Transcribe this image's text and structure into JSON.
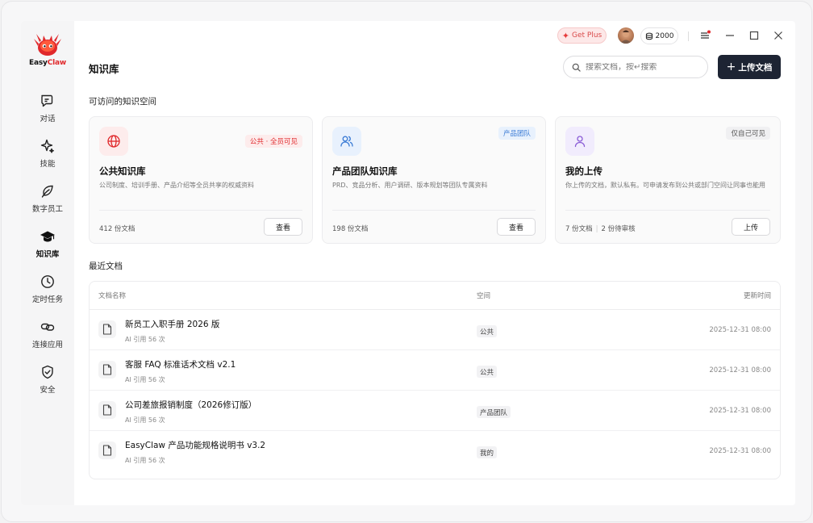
{
  "app": {
    "brand_prefix": "Easy",
    "brand_suffix": "Claw"
  },
  "sidebar": {
    "items": [
      {
        "label": "对话",
        "icon": "chat-icon"
      },
      {
        "label": "技能",
        "icon": "sparkle-icon"
      },
      {
        "label": "数字员工",
        "icon": "leaf-icon"
      },
      {
        "label": "知识库",
        "icon": "graduation-cap-icon",
        "active": true
      },
      {
        "label": "定时任务",
        "icon": "clock-icon"
      },
      {
        "label": "连接应用",
        "icon": "link-icon"
      },
      {
        "label": "安全",
        "icon": "shield-check-icon"
      }
    ]
  },
  "topbar": {
    "get_plus": "Get Plus",
    "credits": "2000"
  },
  "header": {
    "title": "知识库",
    "search_placeholder": "搜索文档，按↵搜索",
    "upload_label": "上传文档"
  },
  "spaces": {
    "section_title": "可访问的知识空间",
    "cards": [
      {
        "title": "公共知识库",
        "badge": "公共 · 全员可见",
        "desc": "公司制度、培训手册、产品介绍等全员共享的权威资料",
        "count": "412 份文档",
        "action": "查看",
        "icon": "globe-icon"
      },
      {
        "title": "产品团队知识库",
        "badge": "产品团队",
        "desc": "PRD、竞品分析、用户调研、版本规划等团队专属资料",
        "count": "198 份文档",
        "action": "查看",
        "icon": "users-icon"
      },
      {
        "title": "我的上传",
        "badge": "仅自己可见",
        "desc": "你上传的文档，默认私有。可申请发布到公共或部门空间让同事也能用",
        "count": "7 份文档",
        "pending": "2 份待审核",
        "action": "上传",
        "icon": "user-icon"
      }
    ]
  },
  "recent": {
    "section_title": "最近文档",
    "columns": [
      "文档名称",
      "空间",
      "更新时间"
    ],
    "rows": [
      {
        "name": "新员工入职手册 2026 版",
        "meta": "AI 引用 56 次",
        "space": "公共",
        "updated": "2025-12-31 08:00"
      },
      {
        "name": "客服 FAQ 标准话术文档 v2.1",
        "meta": "AI 引用 56 次",
        "space": "公共",
        "updated": "2025-12-31 08:00"
      },
      {
        "name": "公司差旅报销制度（2026修订版）",
        "meta": "AI 引用 56 次",
        "space": "产品团队",
        "updated": "2025-12-31 08:00"
      },
      {
        "name": "EasyClaw 产品功能规格说明书 v3.2",
        "meta": "AI 引用 56 次",
        "space": "我的",
        "updated": "2025-12-31 08:00"
      }
    ]
  },
  "colors": {
    "brand_red": "#e0282b",
    "primary_dark": "#1d2433",
    "public_badge_bg": "#fdecec",
    "team_badge_bg": "#e8f1fd",
    "private_badge_bg": "#f0f0f2"
  }
}
